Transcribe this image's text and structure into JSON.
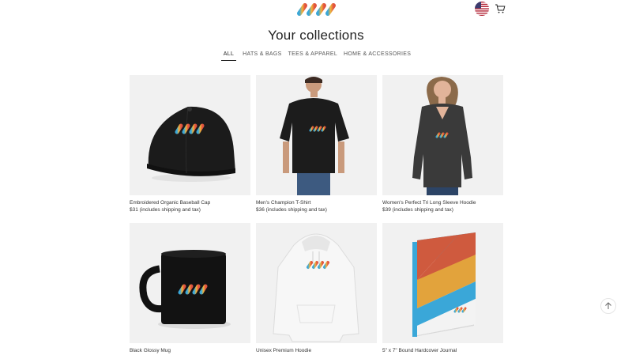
{
  "header": {
    "logo": "logo",
    "flag": "us-flag-icon",
    "cart": "cart-icon"
  },
  "page_title": "Your collections",
  "tabs": [
    {
      "label": "ALL",
      "active": true
    },
    {
      "label": "HATS & BAGS",
      "active": false
    },
    {
      "label": "TEES & APPAREL",
      "active": false
    },
    {
      "label": "HOME & ACCESSORIES",
      "active": false
    }
  ],
  "products": [
    {
      "name": "Embroidered Organic Baseball Cap",
      "price": "$31 (includes shipping and tax)",
      "image": "baseball-cap"
    },
    {
      "name": "Men's Champion T-Shirt",
      "price": "$36 (includes shipping and tax)",
      "image": "mens-tshirt"
    },
    {
      "name": "Women's Perfect Tri Long Sleeve Hoodie",
      "price": "$39 (includes shipping and tax)",
      "image": "womens-long-sleeve"
    },
    {
      "name": "Black Glossy Mug",
      "price": "",
      "image": "black-mug"
    },
    {
      "name": "Unisex Premium Hoodie",
      "price": "",
      "image": "white-hoodie"
    },
    {
      "name": "5\" x 7\" Bound Hardcover Journal",
      "price": "",
      "image": "journal"
    }
  ],
  "colors": {
    "logo_blue": "#3aa7d8",
    "logo_yellow": "#f2b73a",
    "logo_red": "#e2533f",
    "card_bg": "#f1f1f1"
  }
}
